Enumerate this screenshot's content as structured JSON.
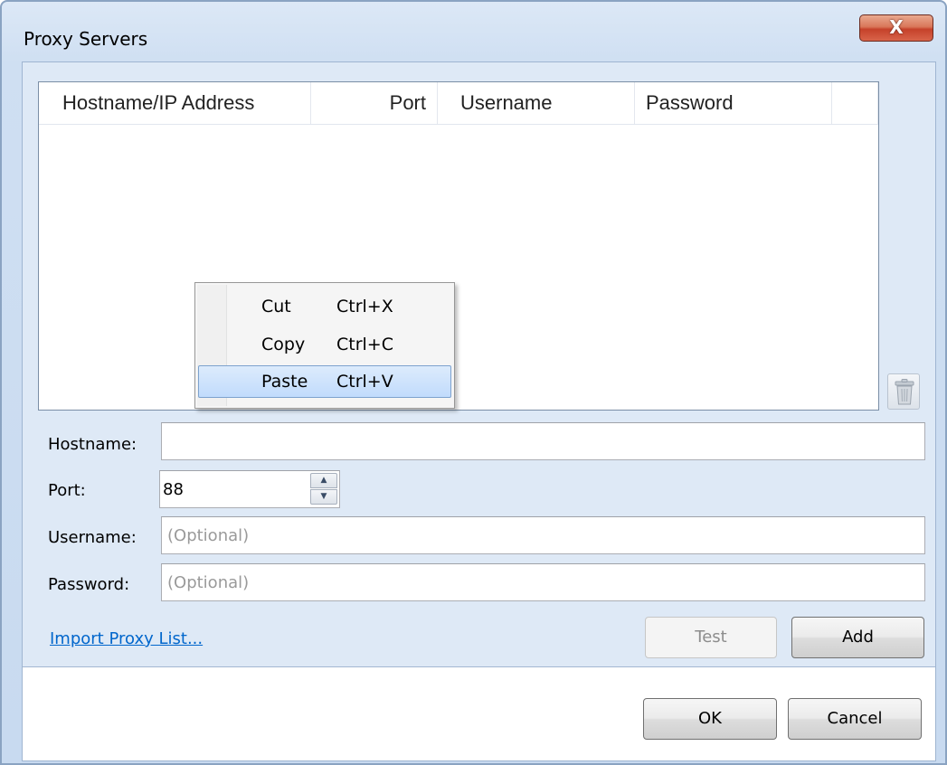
{
  "window": {
    "title": "Proxy Servers",
    "close_glyph": "X"
  },
  "listview": {
    "columns": [
      "Hostname/IP Address",
      "Port",
      "Username",
      "Password"
    ],
    "rows": []
  },
  "form": {
    "hostname_label": "Hostname:",
    "hostname_value": "",
    "port_label": "Port:",
    "port_value": "88",
    "username_label": "Username:",
    "username_placeholder": "(Optional)",
    "password_label": "Password:",
    "password_placeholder": "(Optional)"
  },
  "actions": {
    "import_link": "Import Proxy List...",
    "test_label": "Test",
    "add_label": "Add",
    "ok_label": "OK",
    "cancel_label": "Cancel"
  },
  "context_menu": {
    "items": [
      {
        "label": "Cut",
        "shortcut": "Ctrl+X"
      },
      {
        "label": "Copy",
        "shortcut": "Ctrl+C"
      },
      {
        "label": "Paste",
        "shortcut": "Ctrl+V"
      }
    ]
  },
  "icons": {
    "close": "close-icon",
    "delete": "trash-icon",
    "spin_up": "up-arrow-icon",
    "spin_down": "down-arrow-icon"
  },
  "colors": {
    "link": "#0066cc",
    "close_button": "#c5412a",
    "menu_selection": "#c1dbfc"
  }
}
